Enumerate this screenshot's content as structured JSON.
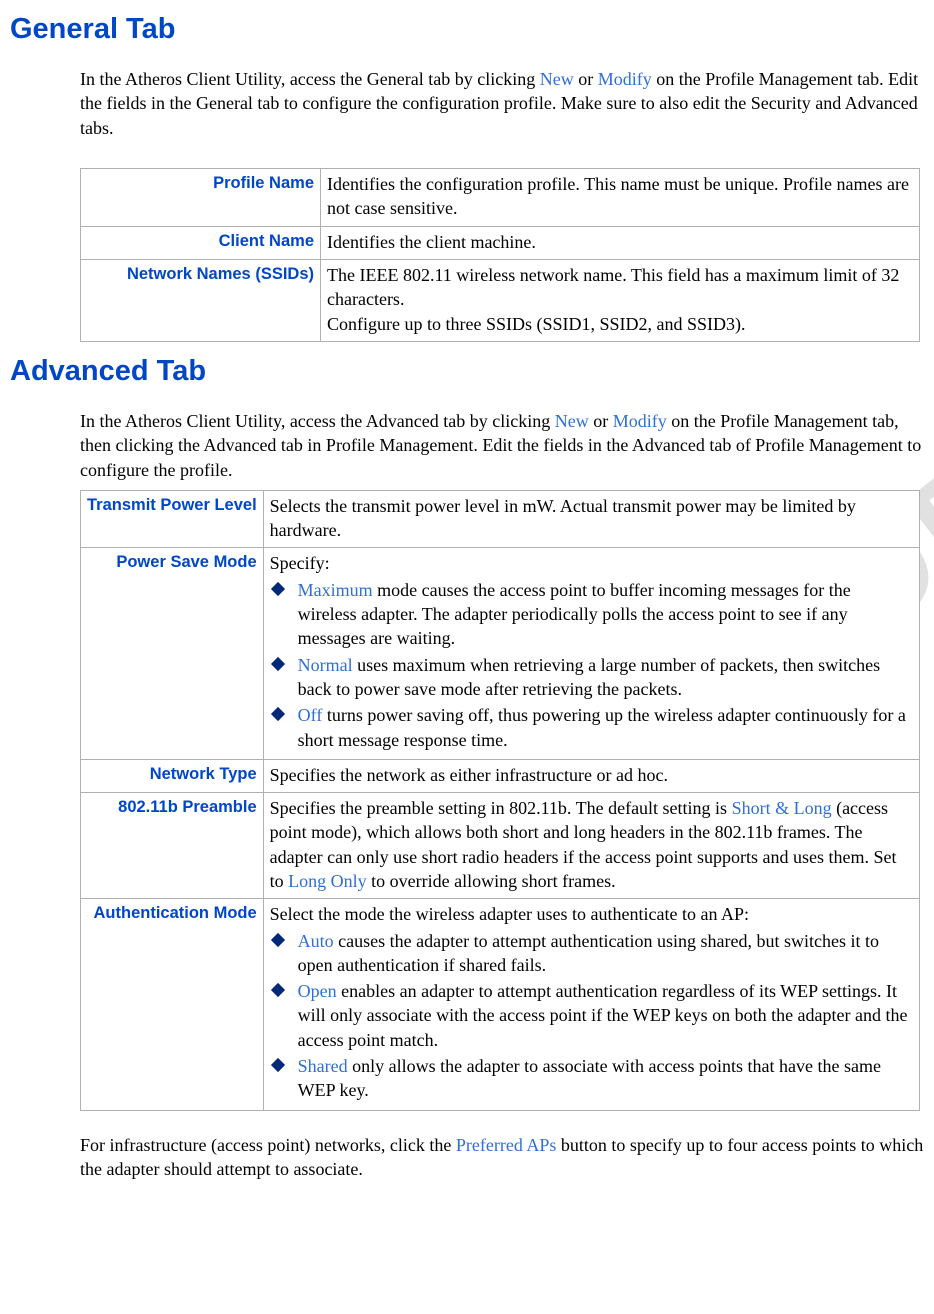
{
  "watermark": "DO NOT COPY",
  "general": {
    "heading": "General Tab",
    "intro_before_new": "In the Atheros Client Utility, access the General tab by clicking ",
    "link_new": "New",
    "intro_or": " or ",
    "link_modify": "Modify",
    "intro_after": " on the Profile Management tab. Edit the fields in the General tab to configure the configuration profile. Make sure to also edit the Security and Advanced tabs.",
    "rows": {
      "profile_name": {
        "label": "Profile Name",
        "desc": "Identifies the configuration profile. This name must be unique. Profile names are not case sensitive."
      },
      "client_name": {
        "label": "Client Name",
        "desc": "Identifies the client machine."
      },
      "ssids": {
        "label": "Network Names (SSIDs)",
        "desc_line1": "The IEEE 802.11 wireless network name. This field has a maximum limit of 32 characters.",
        "desc_line2": "Configure up to three SSIDs (SSID1, SSID2, and SSID3)."
      }
    }
  },
  "advanced": {
    "heading": "Advanced Tab",
    "intro_before_new": "In the Atheros Client Utility, access the Advanced tab by clicking ",
    "link_new": "New",
    "intro_or": " or ",
    "link_modify": "Modify",
    "intro_after": " on the Profile Management tab, then clicking the Advanced tab in Profile Management.  Edit the fields in the Advanced tab of Profile Management to configure the profile.",
    "rows": {
      "tx_power": {
        "label": "Transmit Power Level",
        "desc": "Selects the transmit power level in mW. Actual transmit power may be limited by hardware."
      },
      "power_save": {
        "label": "Power Save Mode",
        "lead": "Specify:",
        "items": {
          "max_term": "Maximum",
          "max_text": " mode causes the  access point to buffer incoming messages for the wireless adapter.  The adapter periodically polls the access point to see if any messages are waiting.",
          "normal_term": "Normal",
          "normal_text": " uses maximum when retrieving a large number of packets, then switches back to power save mode after retrieving the packets.",
          "off_term": "Off",
          "off_text": " turns power saving off, thus powering up the wireless adapter continuously for a short message response time."
        }
      },
      "net_type": {
        "label": "Network Type",
        "desc": "Specifies the network as either infrastructure or ad hoc."
      },
      "preamble": {
        "label": "802.11b Preamble",
        "pre1": "Specifies the preamble setting in 802.11b.  The default setting is ",
        "link_shortlong": "Short & Long",
        "mid": " (access point mode), which allows both short and long headers in the 802.11b frames.  The adapter can only use short radio headers if the access point supports and uses them. Set to ",
        "link_longonly": "Long Only",
        "post": " to override allowing short frames."
      },
      "auth": {
        "label": "Authentication Mode",
        "lead": "Select the mode the wireless adapter uses to authenticate to an AP:",
        "items": {
          "auto_term": "Auto",
          "auto_text": " causes the adapter to attempt authentication using shared, but switches it to open authentication if shared fails.",
          "open_term": "Open",
          "open_text": " enables an adapter to attempt authentication regardless of its WEP settings. It will only associate with the access point if the WEP keys on both the adapter and the access point match.",
          "shared_term": "Shared",
          "shared_text": " only allows the adapter to associate with access points that have the same WEP key."
        }
      }
    },
    "outro_pre": "For infrastructure (access point) networks, click the ",
    "outro_link": "Preferred APs",
    "outro_post": " button to specify up to four access points to which the  adapter should attempt to associate."
  }
}
